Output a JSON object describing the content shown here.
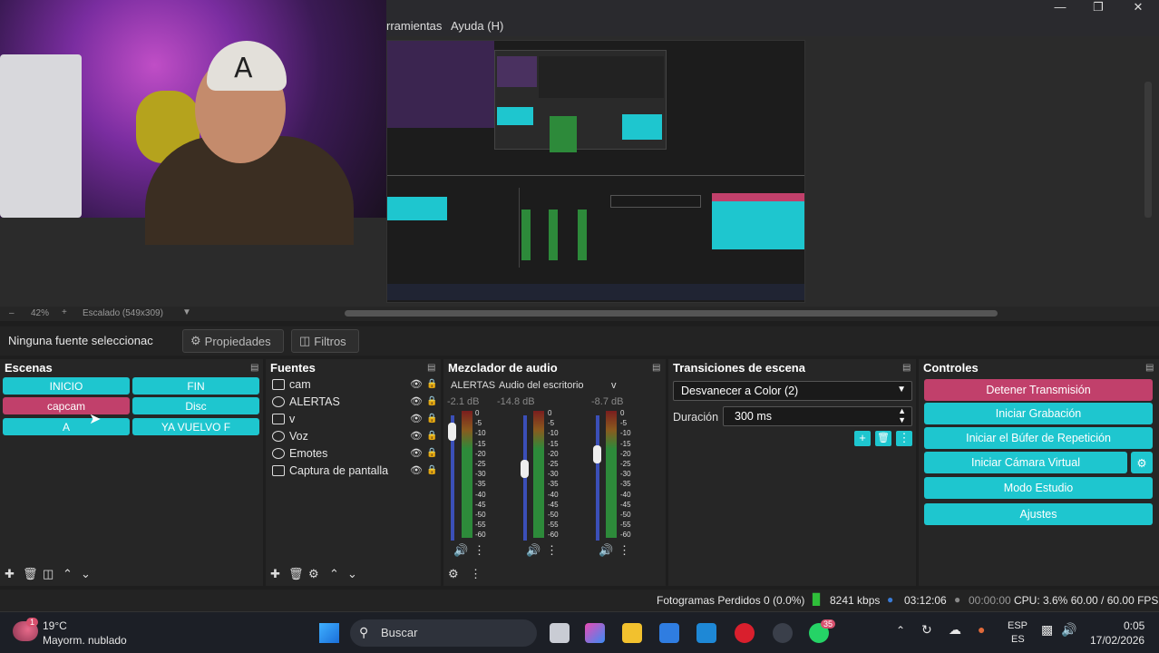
{
  "menubar": {
    "items": [
      "rramientas",
      "Ayuda (H)"
    ],
    "window_controls": [
      "minimize",
      "maximize",
      "close"
    ]
  },
  "preview": {
    "zoom": "42%",
    "scale_text": "Escalado (549x309)"
  },
  "source_bar": {
    "no_source_text": "Ninguna fuente seleccionac",
    "properties_label": "Propiedades",
    "filters_label": "Filtros"
  },
  "scenes": {
    "title": "Escenas",
    "items": [
      {
        "label": "INICIO",
        "state": "normal"
      },
      {
        "label": "FIN",
        "state": "normal"
      },
      {
        "label": "capcam",
        "state": "active"
      },
      {
        "label": "Disc",
        "state": "normal"
      },
      {
        "label": "A",
        "state": "normal"
      },
      {
        "label": "YA VUELVO F",
        "state": "normal"
      }
    ]
  },
  "sources": {
    "title": "Fuentes",
    "items": [
      {
        "label": "cam",
        "icon": "camera-icon"
      },
      {
        "label": "ALERTAS",
        "icon": "globe-icon"
      },
      {
        "label": "v",
        "icon": "media-icon"
      },
      {
        "label": "Voz",
        "icon": "mic-icon"
      },
      {
        "label": "Emotes",
        "icon": "globe-icon"
      },
      {
        "label": "Captura de pantalla",
        "icon": "monitor-icon"
      }
    ]
  },
  "mixer": {
    "title": "Mezclador de audio",
    "channels": [
      {
        "name": "ALERTAS",
        "db": "-2.1 dB"
      },
      {
        "name": "Audio del escritorio",
        "db": "-14.8 dB"
      },
      {
        "name": "v",
        "db": "-8.7 dB"
      }
    ],
    "scale": [
      "0",
      "-5",
      "-10",
      "-15",
      "-20",
      "-25",
      "-30",
      "-35",
      "-40",
      "-45",
      "-50",
      "-55",
      "-60"
    ]
  },
  "transitions": {
    "title": "Transiciones de escena",
    "selected": "Desvanecer a Color (2)",
    "duration_label": "Duración",
    "duration_value": "300 ms"
  },
  "controls": {
    "title": "Controles",
    "buttons": [
      {
        "label": "Detener Transmisión",
        "state": "active"
      },
      {
        "label": "Iniciar Grabación",
        "state": "normal"
      },
      {
        "label": "Iniciar el Búfer de Repetición",
        "state": "normal"
      },
      {
        "label": "Iniciar Cámara Virtual",
        "state": "normal"
      },
      {
        "label": "Modo Estudio",
        "state": "normal"
      },
      {
        "label": "Ajustes",
        "state": "normal"
      }
    ]
  },
  "status": {
    "dropped": "Fotogramas Perdidos 0 (0.0%)",
    "bitrate": "8241 kbps",
    "stream_time": "03:12:06",
    "rec_time": "00:00:00",
    "cpu": "CPU: 3.6% 60.00 / 60.00 FPS"
  },
  "taskbar": {
    "weather_temp": "19°C",
    "weather_desc": "Mayorm. nublado",
    "weather_badge": "1",
    "search_placeholder": "Buscar",
    "whatsapp_badge": "35",
    "lang_top": "ESP",
    "lang_bottom": "ES",
    "time": "0:05",
    "date": "17/02/2026"
  },
  "colors": {
    "accent_cyan": "#1ec6cf",
    "accent_pink": "#c1406b",
    "panel_bg": "#262626"
  }
}
